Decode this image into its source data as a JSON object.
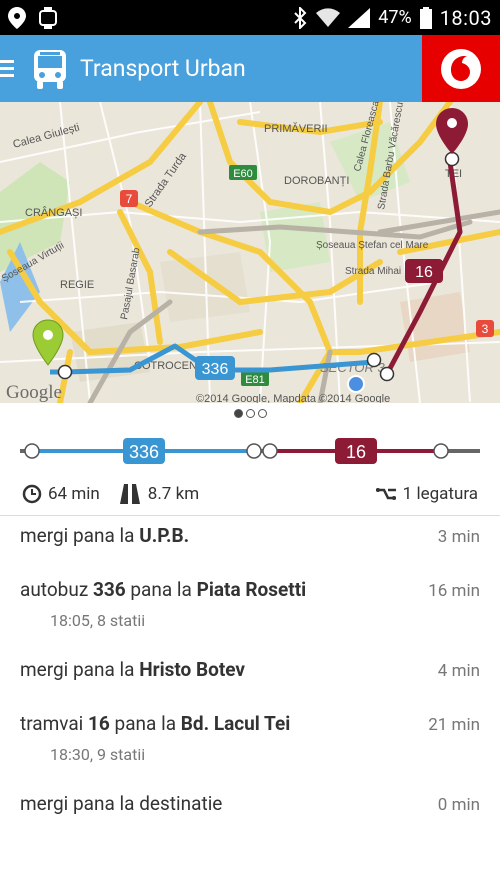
{
  "status_bar": {
    "battery": "47%",
    "time": "18:03"
  },
  "app_bar": {
    "title": "Transport Urban"
  },
  "map": {
    "labels": {
      "calea_giulesti": "Calea Giulești",
      "crangasi": "CRÂNGAȘI",
      "regie": "REGIE",
      "strada_turda": "Strada Turda",
      "primaverii": "PRIMĂVERII",
      "dorobanti": "DOROBANȚI",
      "e60": "E60",
      "e81": "E81",
      "road7": "7",
      "road3": "3",
      "cotroceni": "COTROCENI",
      "sector": "SECTOR 3",
      "sos_stefan": "Șoseaua Ștefan cel Mare",
      "calea_floreasca": "Calea Floreasca",
      "barbu": "Strada Barbu Văcărescu",
      "pasajul": "Pasajul Basarab",
      "virtutii": "Șoseaua Virtuții",
      "mihai": "Strada Mihai",
      "tei": "TEI",
      "google": "Google",
      "copyright": "©2014 Google, Mapdata ©2014 Google"
    },
    "bus_badge": "336",
    "tram_badge": "16"
  },
  "route_bar": {
    "bus_label": "336",
    "tram_label": "16"
  },
  "stats": {
    "duration": "64 min",
    "distance": "8.7 km",
    "transfers": "1 legatura"
  },
  "steps": [
    {
      "pre": "mergi pana la ",
      "b1": "U.P.B.",
      "mid": "",
      "b2": "",
      "duration": "3 min",
      "sub": ""
    },
    {
      "pre": "autobuz ",
      "b1": "336",
      "mid": " pana la ",
      "b2": "Piata Rosetti",
      "duration": "16 min",
      "sub": "18:05, 8 statii"
    },
    {
      "pre": "mergi pana la ",
      "b1": "Hristo Botev",
      "mid": "",
      "b2": "",
      "duration": "4 min",
      "sub": ""
    },
    {
      "pre": "tramvai ",
      "b1": "16",
      "mid": " pana la ",
      "b2": "Bd. Lacul Tei",
      "duration": "21 min",
      "sub": "18:30, 9 statii"
    },
    {
      "pre": "mergi pana la destinatie",
      "b1": "",
      "mid": "",
      "b2": "",
      "duration": "0 min",
      "sub": ""
    }
  ],
  "colors": {
    "app_bar": "#48a0dd",
    "bus": "#3a96d2",
    "tram": "#8e1b35",
    "vodafone": "#e60000"
  }
}
